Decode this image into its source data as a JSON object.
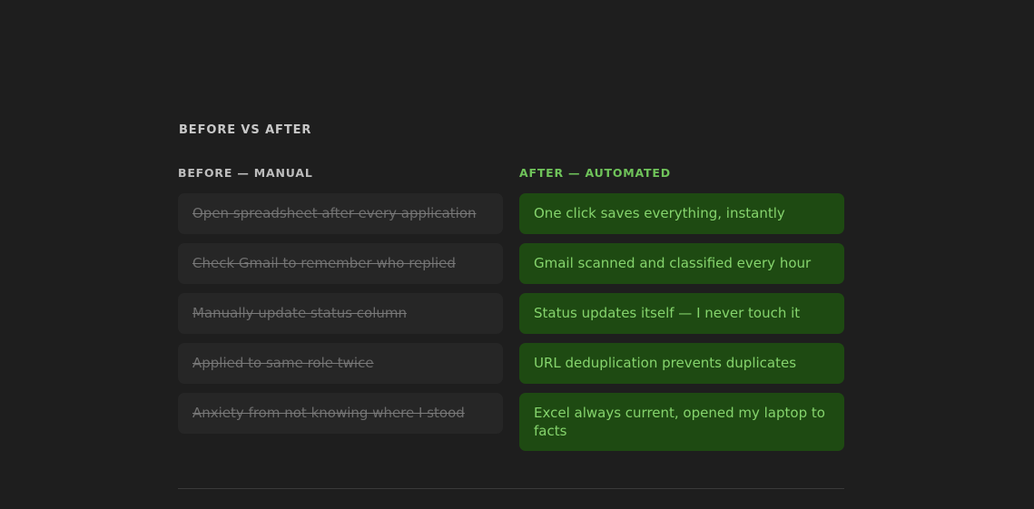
{
  "section_title": "BEFORE VS AFTER",
  "before": {
    "label": "BEFORE — MANUAL",
    "items": [
      "Open spreadsheet after every application",
      "Check Gmail to remember who replied",
      "Manually update status column",
      "Applied to same role twice",
      "Anxiety from not knowing where I stood"
    ]
  },
  "after": {
    "label": "AFTER — AUTOMATED",
    "items": [
      "One click saves everything, instantly",
      "Gmail scanned and classified every hour",
      "Status updates itself — I never touch it",
      "URL deduplication prevents duplicates",
      "Excel always current, opened my laptop to facts"
    ]
  },
  "colors": {
    "background": "#1e1e1e",
    "before_card": "#262626",
    "after_card": "#1e4a12",
    "after_text": "#85d46c"
  }
}
